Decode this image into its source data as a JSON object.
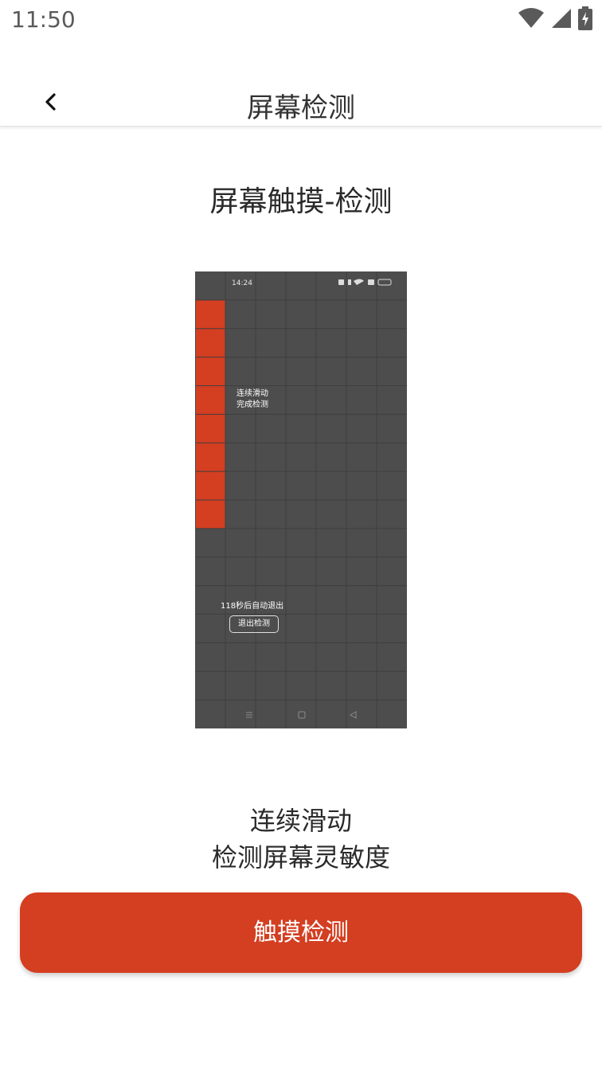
{
  "status_bar": {
    "time": "11:50",
    "icons": [
      "wifi-icon",
      "cellular-signal-icon",
      "battery-charging-icon"
    ]
  },
  "header": {
    "back_icon": "chevron-left-icon",
    "title": "屏幕检测"
  },
  "main": {
    "heading": "屏幕触摸-检测",
    "demo": {
      "time": "14:24",
      "instruction_line1": "连续滑动",
      "instruction_line2": "完成检测",
      "countdown": "118秒后自动退出",
      "exit_button": "退出检测"
    },
    "description_line1": "连续滑动",
    "description_line2": "检测屏幕灵敏度",
    "start_button": "触摸检测"
  },
  "colors": {
    "accent": "#d43e21",
    "demo_background": "#4d4d4d",
    "demo_filled_cell": "#d43e21"
  }
}
